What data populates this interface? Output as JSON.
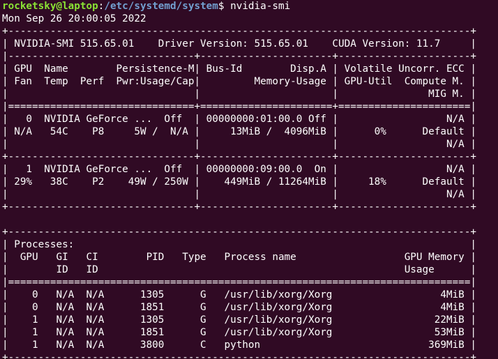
{
  "prompt": {
    "user_host": "rocketsky@laptop",
    "colon": ":",
    "path": "/etc/systemd/system",
    "symbol": "$ ",
    "command": "nvidia-smi"
  },
  "output": {
    "lines": [
      "Mon Sep 26 20:00:05 2022",
      "+-----------------------------------------------------------------------------+",
      "| NVIDIA-SMI 515.65.01    Driver Version: 515.65.01    CUDA Version: 11.7     |",
      "|-------------------------------+----------------------+----------------------+",
      "| GPU  Name        Persistence-M| Bus-Id        Disp.A | Volatile Uncorr. ECC |",
      "| Fan  Temp  Perf  Pwr:Usage/Cap|         Memory-Usage | GPU-Util  Compute M. |",
      "|                               |                      |               MIG M. |",
      "|===============================+======================+======================|",
      "|   0  NVIDIA GeForce ...  Off  | 00000000:01:00.0 Off |                  N/A |",
      "| N/A   54C    P8     5W /  N/A |     13MiB /  4096MiB |      0%      Default |",
      "|                               |                      |                  N/A |",
      "+-------------------------------+----------------------+----------------------+",
      "|   1  NVIDIA GeForce ...  Off  | 00000000:09:00.0  On |                  N/A |",
      "| 29%   38C    P2    49W / 250W |    449MiB / 11264MiB |     18%      Default |",
      "|                               |                      |                  N/A |",
      "+-------------------------------+----------------------+----------------------+",
      "",
      "+-----------------------------------------------------------------------------+",
      "| Processes:                                                                  |",
      "|  GPU   GI   CI        PID   Type   Process name                  GPU Memory |",
      "|        ID   ID                                                   Usage      |",
      "|=============================================================================|",
      "|    0   N/A  N/A      1305      G   /usr/lib/xorg/Xorg                  4MiB |",
      "|    0   N/A  N/A      1851      G   /usr/lib/xorg/Xorg                  4MiB |",
      "|    1   N/A  N/A      1305      G   /usr/lib/xorg/Xorg                 22MiB |",
      "|    1   N/A  N/A      1851      G   /usr/lib/xorg/Xorg                 53MiB |",
      "|    1   N/A  N/A      3800      C   python                            369MiB |",
      "+-----------------------------------------------------------------------------+"
    ]
  },
  "colors": {
    "background": "#300a24",
    "foreground": "#ffffff",
    "prompt_user": "#8ae234",
    "prompt_path": "#729fcf"
  }
}
